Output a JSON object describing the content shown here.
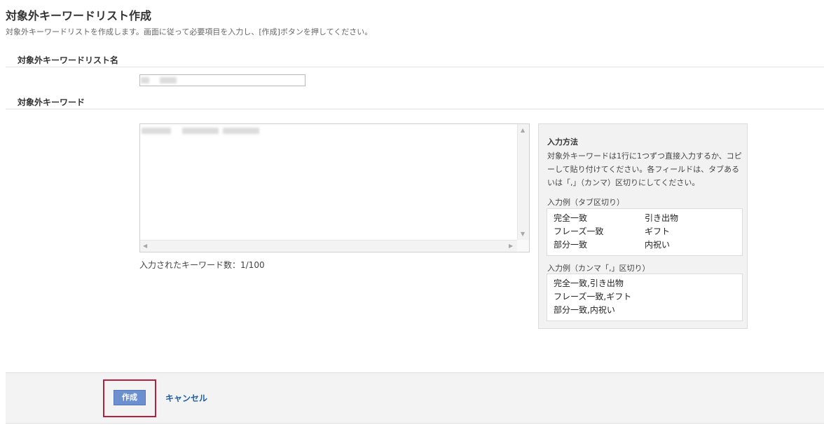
{
  "page": {
    "title": "対象外キーワードリスト作成",
    "description": "対象外キーワードリストを作成します。画面に従って必要項目を入力し、[作成]ボタンを押してください。"
  },
  "form": {
    "name_label": "対象外キーワードリスト名",
    "keywords_label": "対象外キーワード",
    "keyword_count": "入力されたキーワード数：1/100"
  },
  "help": {
    "title": "入力方法",
    "text": "対象外キーワードは1行に1つずつ直接入力するか、コピーして貼り付けてください。各フィールドは、タブあるいは「,」（カンマ）区切りにしてください。",
    "tab_example_label": "入力例（タブ区切り）",
    "tab_example": [
      {
        "match": "完全一致",
        "keyword": "引き出物"
      },
      {
        "match": "フレーズ一致",
        "keyword": "ギフト"
      },
      {
        "match": "部分一致",
        "keyword": "内祝い"
      }
    ],
    "comma_example_label": "入力例（カンマ「,」区切り）",
    "comma_example": [
      "完全一致,引き出物",
      "フレーズ一致,ギフト",
      "部分一致,内祝い"
    ]
  },
  "footer": {
    "create_label": "作成",
    "cancel_label": "キャンセル"
  },
  "colors": {
    "create_button": "#6c8fd0",
    "cancel_link": "#215f9e",
    "highlight": "#b22240"
  }
}
